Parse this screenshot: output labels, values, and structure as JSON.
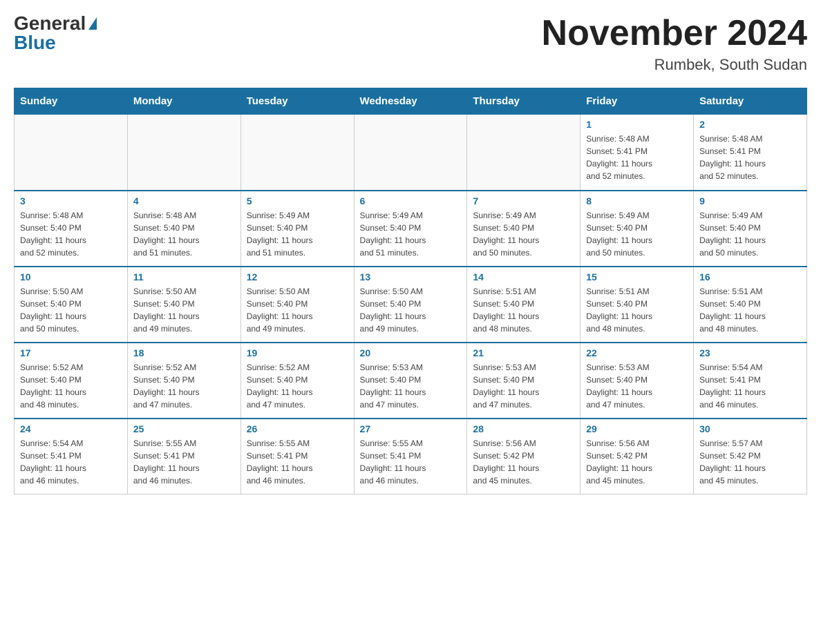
{
  "header": {
    "logo_general": "General",
    "logo_blue": "Blue",
    "title": "November 2024",
    "location": "Rumbek, South Sudan"
  },
  "weekdays": [
    "Sunday",
    "Monday",
    "Tuesday",
    "Wednesday",
    "Thursday",
    "Friday",
    "Saturday"
  ],
  "weeks": [
    [
      {
        "day": "",
        "info": ""
      },
      {
        "day": "",
        "info": ""
      },
      {
        "day": "",
        "info": ""
      },
      {
        "day": "",
        "info": ""
      },
      {
        "day": "",
        "info": ""
      },
      {
        "day": "1",
        "info": "Sunrise: 5:48 AM\nSunset: 5:41 PM\nDaylight: 11 hours\nand 52 minutes."
      },
      {
        "day": "2",
        "info": "Sunrise: 5:48 AM\nSunset: 5:41 PM\nDaylight: 11 hours\nand 52 minutes."
      }
    ],
    [
      {
        "day": "3",
        "info": "Sunrise: 5:48 AM\nSunset: 5:40 PM\nDaylight: 11 hours\nand 52 minutes."
      },
      {
        "day": "4",
        "info": "Sunrise: 5:48 AM\nSunset: 5:40 PM\nDaylight: 11 hours\nand 51 minutes."
      },
      {
        "day": "5",
        "info": "Sunrise: 5:49 AM\nSunset: 5:40 PM\nDaylight: 11 hours\nand 51 minutes."
      },
      {
        "day": "6",
        "info": "Sunrise: 5:49 AM\nSunset: 5:40 PM\nDaylight: 11 hours\nand 51 minutes."
      },
      {
        "day": "7",
        "info": "Sunrise: 5:49 AM\nSunset: 5:40 PM\nDaylight: 11 hours\nand 50 minutes."
      },
      {
        "day": "8",
        "info": "Sunrise: 5:49 AM\nSunset: 5:40 PM\nDaylight: 11 hours\nand 50 minutes."
      },
      {
        "day": "9",
        "info": "Sunrise: 5:49 AM\nSunset: 5:40 PM\nDaylight: 11 hours\nand 50 minutes."
      }
    ],
    [
      {
        "day": "10",
        "info": "Sunrise: 5:50 AM\nSunset: 5:40 PM\nDaylight: 11 hours\nand 50 minutes."
      },
      {
        "day": "11",
        "info": "Sunrise: 5:50 AM\nSunset: 5:40 PM\nDaylight: 11 hours\nand 49 minutes."
      },
      {
        "day": "12",
        "info": "Sunrise: 5:50 AM\nSunset: 5:40 PM\nDaylight: 11 hours\nand 49 minutes."
      },
      {
        "day": "13",
        "info": "Sunrise: 5:50 AM\nSunset: 5:40 PM\nDaylight: 11 hours\nand 49 minutes."
      },
      {
        "day": "14",
        "info": "Sunrise: 5:51 AM\nSunset: 5:40 PM\nDaylight: 11 hours\nand 48 minutes."
      },
      {
        "day": "15",
        "info": "Sunrise: 5:51 AM\nSunset: 5:40 PM\nDaylight: 11 hours\nand 48 minutes."
      },
      {
        "day": "16",
        "info": "Sunrise: 5:51 AM\nSunset: 5:40 PM\nDaylight: 11 hours\nand 48 minutes."
      }
    ],
    [
      {
        "day": "17",
        "info": "Sunrise: 5:52 AM\nSunset: 5:40 PM\nDaylight: 11 hours\nand 48 minutes."
      },
      {
        "day": "18",
        "info": "Sunrise: 5:52 AM\nSunset: 5:40 PM\nDaylight: 11 hours\nand 47 minutes."
      },
      {
        "day": "19",
        "info": "Sunrise: 5:52 AM\nSunset: 5:40 PM\nDaylight: 11 hours\nand 47 minutes."
      },
      {
        "day": "20",
        "info": "Sunrise: 5:53 AM\nSunset: 5:40 PM\nDaylight: 11 hours\nand 47 minutes."
      },
      {
        "day": "21",
        "info": "Sunrise: 5:53 AM\nSunset: 5:40 PM\nDaylight: 11 hours\nand 47 minutes."
      },
      {
        "day": "22",
        "info": "Sunrise: 5:53 AM\nSunset: 5:40 PM\nDaylight: 11 hours\nand 47 minutes."
      },
      {
        "day": "23",
        "info": "Sunrise: 5:54 AM\nSunset: 5:41 PM\nDaylight: 11 hours\nand 46 minutes."
      }
    ],
    [
      {
        "day": "24",
        "info": "Sunrise: 5:54 AM\nSunset: 5:41 PM\nDaylight: 11 hours\nand 46 minutes."
      },
      {
        "day": "25",
        "info": "Sunrise: 5:55 AM\nSunset: 5:41 PM\nDaylight: 11 hours\nand 46 minutes."
      },
      {
        "day": "26",
        "info": "Sunrise: 5:55 AM\nSunset: 5:41 PM\nDaylight: 11 hours\nand 46 minutes."
      },
      {
        "day": "27",
        "info": "Sunrise: 5:55 AM\nSunset: 5:41 PM\nDaylight: 11 hours\nand 46 minutes."
      },
      {
        "day": "28",
        "info": "Sunrise: 5:56 AM\nSunset: 5:42 PM\nDaylight: 11 hours\nand 45 minutes."
      },
      {
        "day": "29",
        "info": "Sunrise: 5:56 AM\nSunset: 5:42 PM\nDaylight: 11 hours\nand 45 minutes."
      },
      {
        "day": "30",
        "info": "Sunrise: 5:57 AM\nSunset: 5:42 PM\nDaylight: 11 hours\nand 45 minutes."
      }
    ]
  ]
}
